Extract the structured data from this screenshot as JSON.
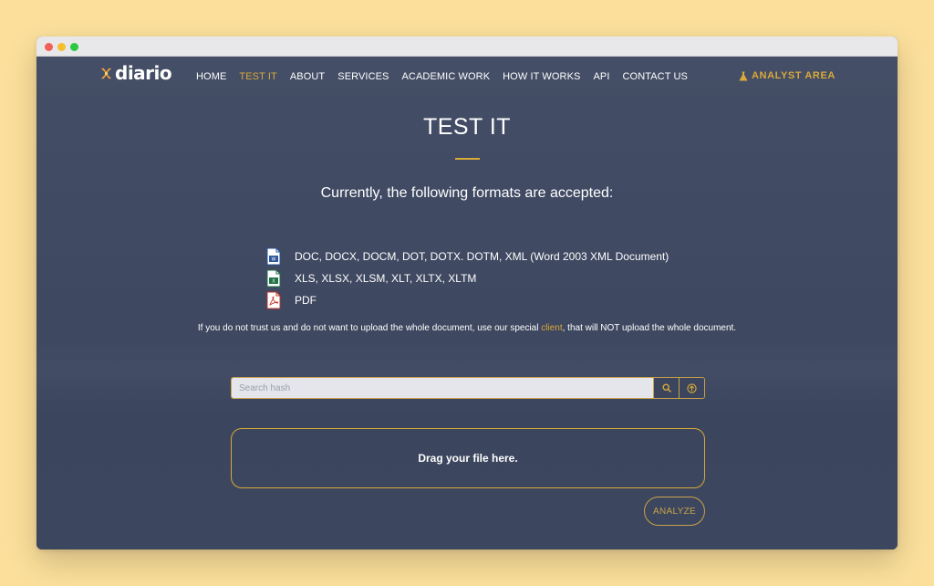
{
  "brand": {
    "logo_text": "diario",
    "accent_color": "#d9a93a"
  },
  "nav": {
    "items": [
      {
        "label": "HOME",
        "active": false
      },
      {
        "label": "TEST IT",
        "active": true
      },
      {
        "label": "ABOUT",
        "active": false
      },
      {
        "label": "SERVICES",
        "active": false
      },
      {
        "label": "ACADEMIC WORK",
        "active": false
      },
      {
        "label": "HOW IT WORKS",
        "active": false
      },
      {
        "label": "API",
        "active": false
      },
      {
        "label": "CONTACT US",
        "active": false
      }
    ],
    "analyst_area": "ANALYST AREA",
    "analyst_icon": "flask-icon"
  },
  "main": {
    "title": "TEST IT",
    "formats_heading": "Currently, the following formats are accepted:",
    "formats": [
      {
        "icon": "word-file-icon",
        "color": "#2b579a",
        "text": "DOC, DOCX, DOCM, DOT, DOTX. DOTM, XML (Word 2003 XML Document)"
      },
      {
        "icon": "excel-file-icon",
        "color": "#217346",
        "text": "XLS, XLSX, XLSM, XLT, XLTX, XLTM"
      },
      {
        "icon": "pdf-file-icon",
        "color": "#c0392b",
        "text": "PDF"
      }
    ],
    "note_before": "If you do not trust us and do not want to upload the whole document, use our special ",
    "note_link": "client",
    "note_after": ", that will NOT upload the whole document."
  },
  "search": {
    "placeholder": "Search hash",
    "search_icon": "search-icon",
    "upload_icon": "upload-icon"
  },
  "dropzone": {
    "label": "Drag your file here."
  },
  "analyze_button": "ANALYZE"
}
